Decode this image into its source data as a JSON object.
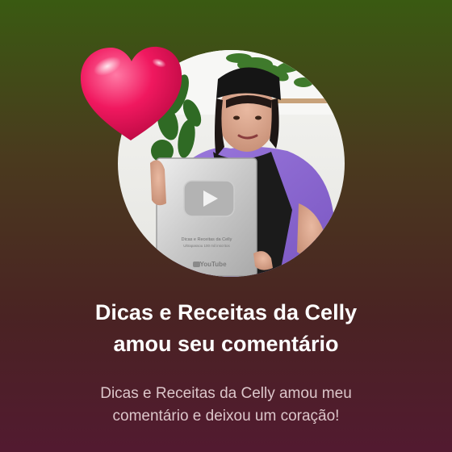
{
  "notification": {
    "title_line1": "Dicas e Receitas da Celly",
    "title_line2": "amou seu comentário",
    "message_line1": "Dicas e Receitas da Celly amou meu",
    "message_line2": "comentário e deixou um coração!"
  },
  "plaque": {
    "caption_line1": "Dicas e Receitas da Celly",
    "caption_line2": "Ultrapassou 100 mil inscritos",
    "brand": "YouTube"
  },
  "icons": {
    "heart": "heart-icon",
    "play": "youtube-play-icon"
  },
  "colors": {
    "gradient_top": "#3a5a12",
    "gradient_bottom": "#521a30",
    "heart": "#e8155a",
    "apron": "#1b1b1b",
    "shirt": "#8f6ad2",
    "title": "#ffffff",
    "message": "#dcc6ca"
  }
}
